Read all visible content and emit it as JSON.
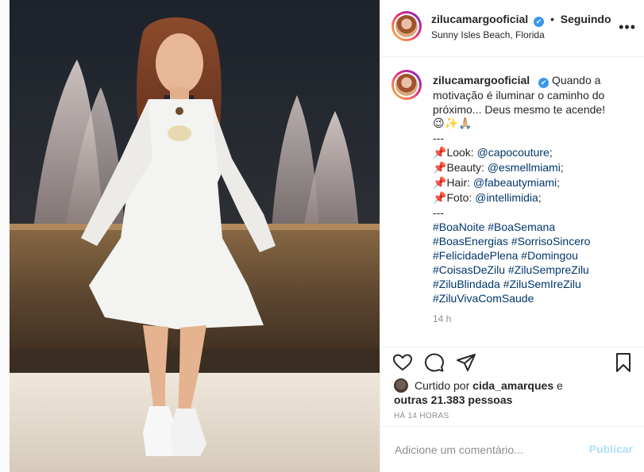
{
  "post": {
    "username": "zilucamargooficial",
    "verified_glyph": "✔",
    "separator": "•",
    "following_label": "Seguindo",
    "location": "Sunny Isles Beach, Florida",
    "more_glyph": "•••"
  },
  "caption": {
    "username": "zilucamargooficial",
    "text_line1": "Quando a motivação é iluminar o caminho do próximo... Deus mesmo te acende!",
    "emojis": "😉✨🙏🏼",
    "separator1": "---",
    "look_label": "Look: ",
    "look_mention": "@capocouture",
    "beauty_label": "Beauty: ",
    "beauty_mention": "@esmellmiami",
    "hair_label": "Hair: ",
    "hair_mention": "@fabeautymiami",
    "foto_label": "Foto: ",
    "foto_mention": "@intellimidia",
    "separator2": "---",
    "hashtags": [
      "#BoaNoite #BoaSemana",
      "#BoasEnergias #SorrisoSincero",
      "#FelicidadePlena #Domingou",
      "#CoisasDeZilu #ZiluSempreZilu",
      "#ZiluBlindada #ZiluSemIreZilu",
      "#ZiluVivaComSaude"
    ],
    "time_ago": "14 h"
  },
  "likes": {
    "prefix": "Curtido por",
    "user": "cida_amarques",
    "conj": "e",
    "others": "outras 21.383 pessoas"
  },
  "posted_ago": "HÁ 14 HORAS",
  "comment": {
    "placeholder": "Adicione um comentário...",
    "publish_label": "Publicar"
  },
  "colors": {
    "link": "#00376b",
    "verified": "#3897f0",
    "publish_disabled": "#b2dffc"
  },
  "icons": [
    "heart-icon",
    "comment-icon",
    "share-icon",
    "bookmark-icon",
    "more-options-icon",
    "verified-icon",
    "pin-icon"
  ]
}
